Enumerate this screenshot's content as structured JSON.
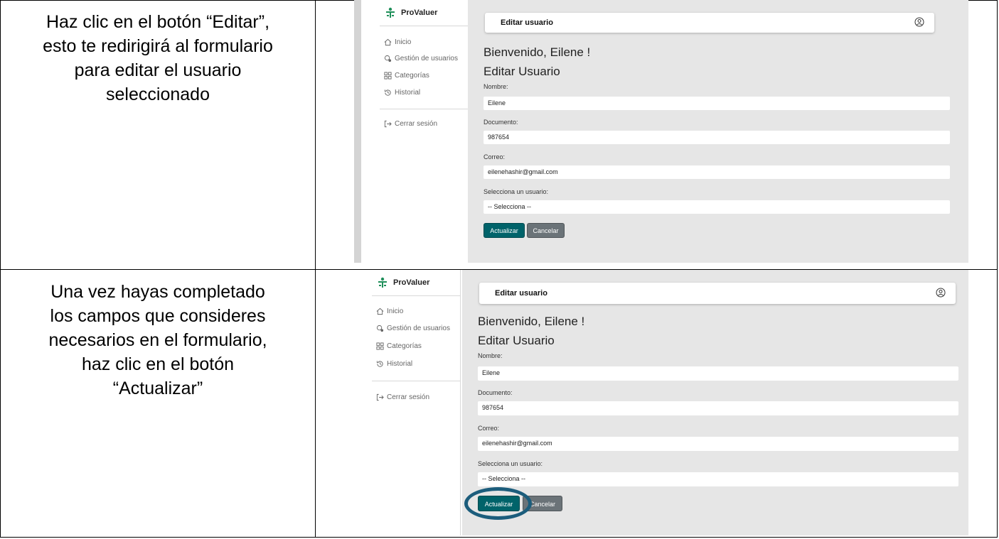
{
  "instructions": [
    [
      "Haz clic en el botón “Editar”,",
      "esto te redirigirá al formulario",
      "para editar el usuario",
      "seleccionado"
    ],
    [
      "Una vez hayas completado",
      "los campos que consideres",
      "necesarios en el formulario,",
      "haz clic en el botón",
      "“Actualizar”"
    ]
  ],
  "app": {
    "logo_text": "ProValuer",
    "nav": [
      {
        "label": "Inicio",
        "icon": "home-icon"
      },
      {
        "label": "Gestión de usuarios",
        "icon": "user-gear-icon"
      },
      {
        "label": "Categorías",
        "icon": "grid-icon"
      },
      {
        "label": "Historial",
        "icon": "history-icon"
      }
    ],
    "logout_label": "Cerrar sesión",
    "header_title": "Editar usuario",
    "welcome": "Bienvenido, Eilene !",
    "form_title": "Editar Usuario",
    "fields": {
      "nombre_label": "Nombre:",
      "nombre_value": "Eilene",
      "documento_label": "Documento:",
      "documento_value": "987654",
      "correo_label": "Correo:",
      "correo_value": "eilenehashir@gmail.com",
      "select_label": "Selecciona un usuario:",
      "select_value": "-- Selecciona --"
    },
    "update_button": "Actualizar",
    "cancel_button": "Cancelar"
  },
  "colors": {
    "primary_button": "#00636a",
    "secondary_button": "#6b7378",
    "highlight_ring": "#1c5d7c",
    "main_bg": "#e6e6e6"
  }
}
